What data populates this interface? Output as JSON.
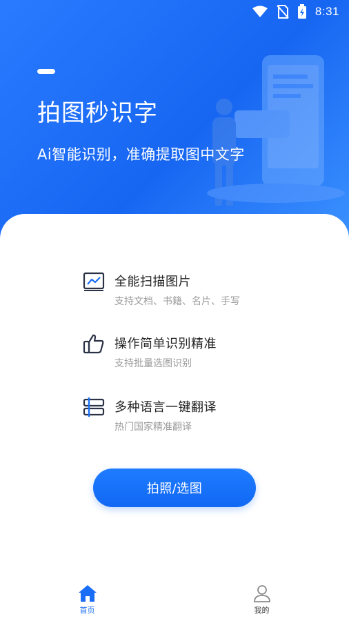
{
  "status_bar": {
    "time": "8:31"
  },
  "hero": {
    "title": "拍图秒识字",
    "subtitle": "Ai智能识别，准确提取图中文字"
  },
  "features": [
    {
      "icon": "image-chart-icon",
      "title": "全能扫描图片",
      "desc": "支持文档、书籍、名片、手写"
    },
    {
      "icon": "thumbs-up-icon",
      "title": "操作简单识别精准",
      "desc": "支持批量选图识别"
    },
    {
      "icon": "translate-icon",
      "title": "多种语言一键翻译",
      "desc": "热门国家精准翻译"
    }
  ],
  "primary_button": {
    "label": "拍照/选图"
  },
  "tab_bar": {
    "tabs": [
      {
        "label": "首页",
        "icon": "home-icon",
        "active": true
      },
      {
        "label": "我的",
        "icon": "user-icon",
        "active": false
      }
    ]
  },
  "colors": {
    "accent": "#1a6ef5",
    "hero_start": "#2a7bff",
    "hero_end": "#1766f2"
  }
}
